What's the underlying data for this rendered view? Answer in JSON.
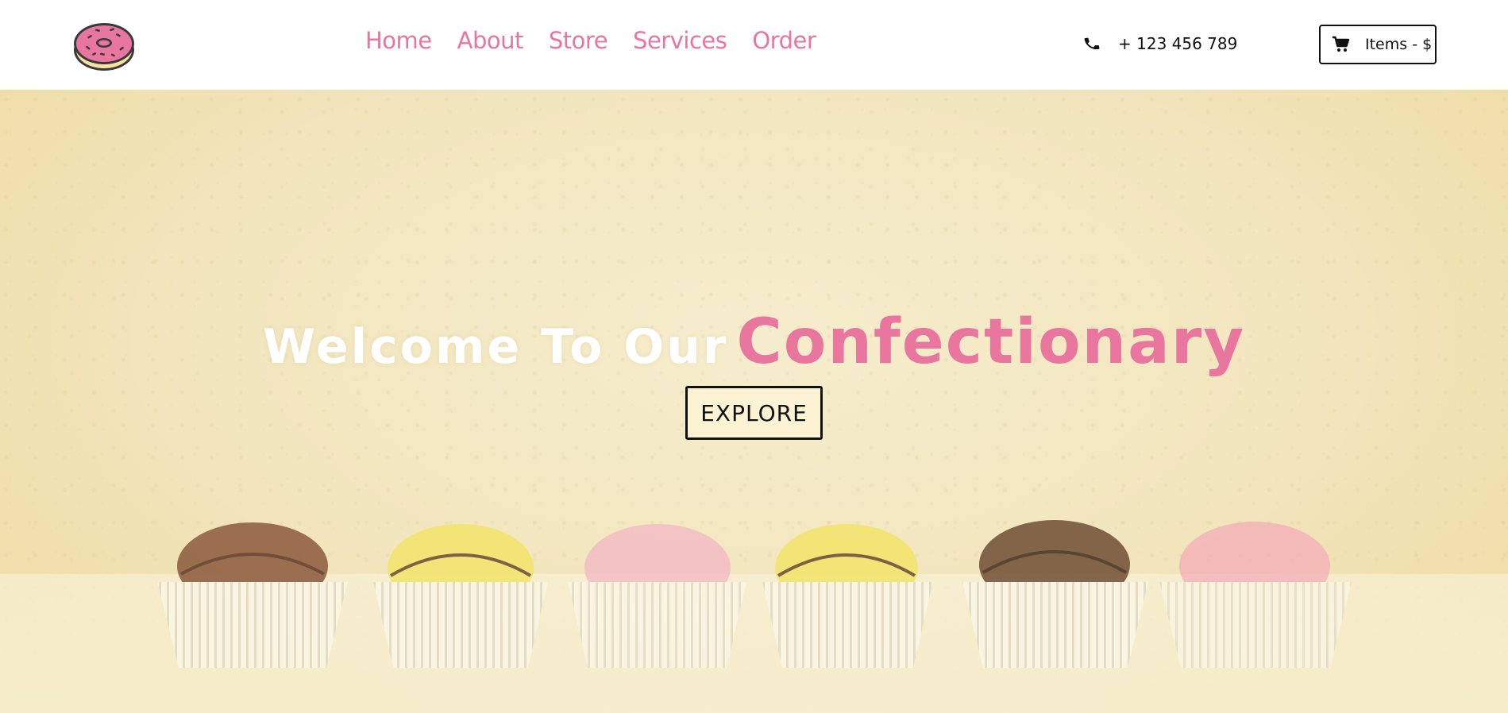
{
  "brand": {
    "logo_icon": "donut-icon",
    "colors": {
      "accent": "#e9769f",
      "hero_background": "#f2e5bd",
      "text_dark": "#111111"
    }
  },
  "nav": {
    "items": [
      {
        "label": "Home"
      },
      {
        "label": "About"
      },
      {
        "label": "Store"
      },
      {
        "label": "Services"
      },
      {
        "label": "Order"
      }
    ]
  },
  "contact": {
    "phone_icon": "phone-icon",
    "phone": "+ 123 456 789"
  },
  "cart": {
    "icon": "cart-icon",
    "label": "Items - $"
  },
  "hero": {
    "headline_prefix": "Welcome To Our",
    "headline_highlight": "Confectionary",
    "button_label": "EXPLORE"
  }
}
